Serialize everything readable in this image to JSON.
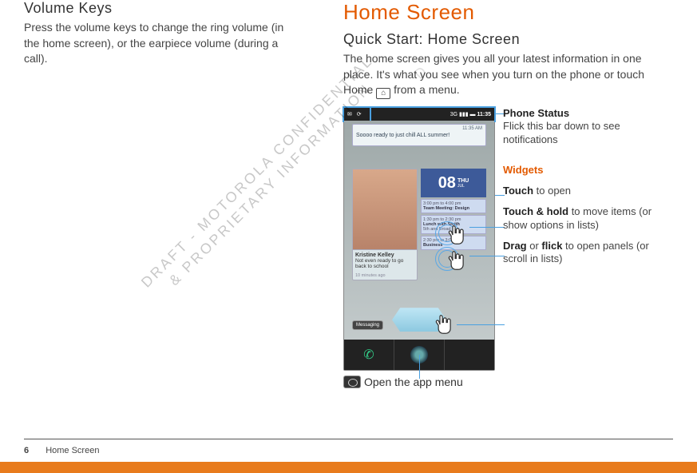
{
  "left": {
    "title": "Volume Keys",
    "body": "Press the volume keys to change the ring volume (in the home screen), or the earpiece volume (during a call)."
  },
  "right": {
    "major": "Home Screen",
    "subtitle": "Quick Start: Home Screen",
    "body_a": "The home screen gives you all your latest information in one place. It's what you see when you turn on the phone or touch Home",
    "body_b": "from a menu."
  },
  "phone": {
    "status_left_icons": "✉ ⟳",
    "status_net": "3G",
    "status_signal": "▮▮▮",
    "status_batt": "▬",
    "clock": "11:35",
    "social": {
      "text": "Soooo ready to just chill ALL summer!",
      "time": "11:35 AM"
    },
    "friend": {
      "name": "Kristine Kelley",
      "text": "Not even ready to go back to school",
      "ago": "10 minutes ago"
    },
    "date": {
      "num": "08",
      "day": "THU",
      "mon": "JUL"
    },
    "events": [
      {
        "time": "3:00 pm to 4:00 pm",
        "label": "Team Meeting: Design"
      },
      {
        "time": "1:30 pm to 2:30 pm",
        "label": "Lunch with Smith"
      },
      {
        "time": "5th and Broad",
        "label": ""
      },
      {
        "time": "2:30 pm to 3:00 pm",
        "label": "Business"
      }
    ],
    "messaging_label": "Messaging"
  },
  "callouts": {
    "status": {
      "title": "Phone Status",
      "body": "Flick this bar down to see notifications"
    },
    "widgets": "Widgets",
    "touch_open_a": "Touch",
    "touch_open_b": " to open",
    "touch_hold_a": "Touch & hold",
    "touch_hold_b": " to move items (or show options in lists)",
    "drag_a": "Drag",
    "drag_b": " or ",
    "drag_c": "flick",
    "drag_d": " to open panels (or scroll in lists)",
    "app_menu": "Open the app menu"
  },
  "watermark_a": "DRAFT - MOTOROLA CONFIDENTIAL",
  "watermark_b": "& PROPRIETARY INFORMATION",
  "watermark_short": "D",
  "footer": {
    "page": "6",
    "section": "Home Screen"
  }
}
